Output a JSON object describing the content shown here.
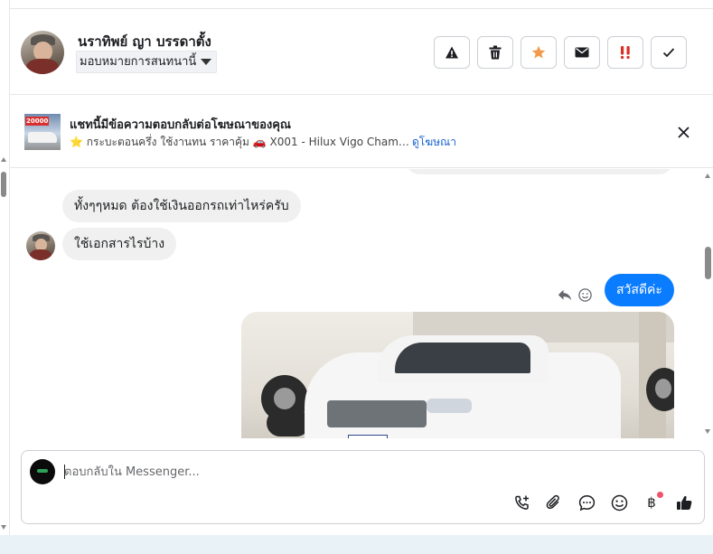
{
  "header": {
    "contact_name": "นราทิพย์ ญา บรรดาตั้ง",
    "assign_label": "มอบหมายการสนทนานี้",
    "actions": [
      {
        "name": "report-spam-button",
        "icon": "warning-icon"
      },
      {
        "name": "delete-button",
        "icon": "trash-icon"
      },
      {
        "name": "star-button",
        "icon": "star-icon"
      },
      {
        "name": "mark-unread-button",
        "icon": "envelope-icon"
      },
      {
        "name": "follow-up-button",
        "icon": "exclamation-icon"
      },
      {
        "name": "mark-done-button",
        "icon": "check-icon"
      }
    ]
  },
  "ad": {
    "thumb_tag": "20000",
    "title": "แชทนี้มีข้อความตอบกลับต่อโฆษณาของคุณ",
    "subtitle": "⭐ กระบะตอนครึ่ง ใช้งานทน ราคาคุ้ม 🚗 X001 - Hilux Vigo Champ Ca...",
    "link": "ดูโฆษณา"
  },
  "messages": [
    {
      "direction": "incoming",
      "text": "ทั้งๆๆหมด ต้องใช้เงินออกรถเท่าไหร่ครับ"
    },
    {
      "direction": "incoming",
      "text": "ใช้เอกสารไรบ้าง"
    },
    {
      "direction": "outgoing",
      "text": "สวัสดีค่ะ"
    },
    {
      "direction": "outgoing",
      "type": "image",
      "subject": "white pickup truck in garage"
    }
  ],
  "composer": {
    "placeholder": "ตอบกลับใน Messenger...",
    "currency_symbol": "฿",
    "tools": [
      "phone-plus-icon",
      "paperclip-icon",
      "chat-bubble-icon",
      "smiley-icon",
      "baht-icon",
      "thumbs-up-icon"
    ]
  },
  "colors": {
    "outgoing_bubble": "#0a7cff",
    "incoming_bubble": "#f0f0f0",
    "star": "#f2994a",
    "follow_up": "#d93025",
    "link": "#1763cf"
  }
}
